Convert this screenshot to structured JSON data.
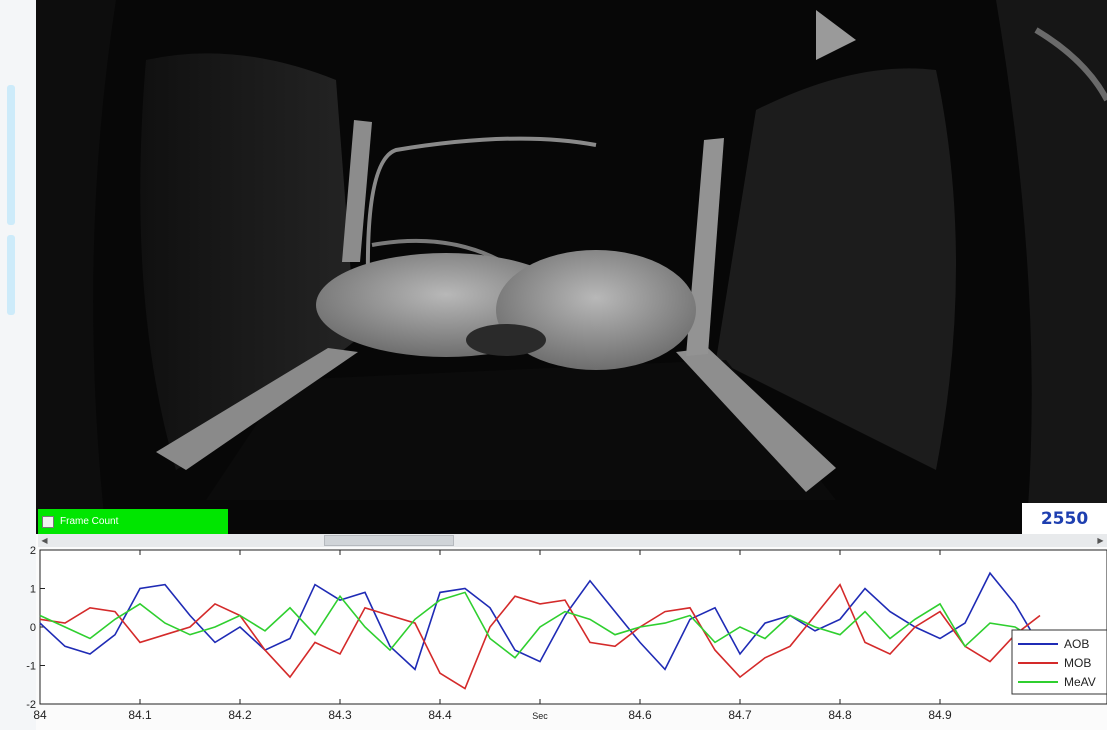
{
  "frame_count": {
    "label": "Frame Count",
    "value": "2550"
  },
  "icons": {
    "scroll_left": "arrow-left-icon",
    "scroll_right": "arrow-right-icon",
    "checkbox": "checkbox-icon"
  },
  "colors": {
    "frame_count_bar": "#00e600",
    "frame_number_text": "#1e3fb0"
  },
  "chart_data": {
    "type": "line",
    "xlabel": "Sec",
    "xlim": [
      84,
      85
    ],
    "ylim": [
      -2,
      2
    ],
    "x_ticks": [
      "84",
      "84.1",
      "84.2",
      "84.3",
      "84.4",
      "Sec",
      "84.6",
      "84.7",
      "84.8",
      "84.9"
    ],
    "y_ticks": [
      "2",
      "1",
      "0",
      "-1",
      "-2"
    ],
    "legend": "bottom-right",
    "x": [
      84.0,
      84.025,
      84.05,
      84.075,
      84.1,
      84.125,
      84.15,
      84.175,
      84.2,
      84.225,
      84.25,
      84.275,
      84.3,
      84.325,
      84.35,
      84.375,
      84.4,
      84.425,
      84.45,
      84.475,
      84.5,
      84.525,
      84.55,
      84.575,
      84.6,
      84.625,
      84.65,
      84.675,
      84.7,
      84.725,
      84.75,
      84.775,
      84.8,
      84.825,
      84.85,
      84.875,
      84.9,
      84.925,
      84.95,
      84.975,
      85.0
    ],
    "series": [
      {
        "name": "AOB",
        "color": "#1f2bb5",
        "values": [
          0.1,
          -0.5,
          -0.7,
          -0.2,
          1.0,
          1.1,
          0.3,
          -0.4,
          0.0,
          -0.6,
          -0.3,
          1.1,
          0.7,
          0.9,
          -0.5,
          -1.1,
          0.9,
          1.0,
          0.5,
          -0.6,
          -0.9,
          0.3,
          1.2,
          0.4,
          -0.4,
          -1.1,
          0.2,
          0.5,
          -0.7,
          0.1,
          0.3,
          -0.1,
          0.2,
          1.0,
          0.4,
          0.0,
          -0.3,
          0.1,
          1.4,
          0.6,
          -0.5
        ]
      },
      {
        "name": "MOB",
        "color": "#d42a2a",
        "values": [
          0.2,
          0.1,
          0.5,
          0.4,
          -0.4,
          -0.2,
          0.0,
          0.6,
          0.3,
          -0.6,
          -1.3,
          -0.4,
          -0.7,
          0.5,
          0.3,
          0.1,
          -1.2,
          -1.6,
          0.0,
          0.8,
          0.6,
          0.7,
          -0.4,
          -0.5,
          0.0,
          0.4,
          0.5,
          -0.6,
          -1.3,
          -0.8,
          -0.5,
          0.3,
          1.1,
          -0.4,
          -0.7,
          0.0,
          0.4,
          -0.5,
          -0.9,
          -0.2,
          0.3
        ]
      },
      {
        "name": "MeAV",
        "color": "#2fcf2f",
        "values": [
          0.3,
          0.0,
          -0.3,
          0.2,
          0.6,
          0.1,
          -0.2,
          0.0,
          0.3,
          -0.1,
          0.5,
          -0.2,
          0.8,
          0.0,
          -0.6,
          0.2,
          0.7,
          0.9,
          -0.3,
          -0.8,
          0.0,
          0.4,
          0.2,
          -0.2,
          0.0,
          0.1,
          0.3,
          -0.4,
          0.0,
          -0.3,
          0.3,
          0.0,
          -0.2,
          0.4,
          -0.3,
          0.2,
          0.6,
          -0.5,
          0.1,
          0.0,
          -0.4
        ]
      }
    ]
  }
}
